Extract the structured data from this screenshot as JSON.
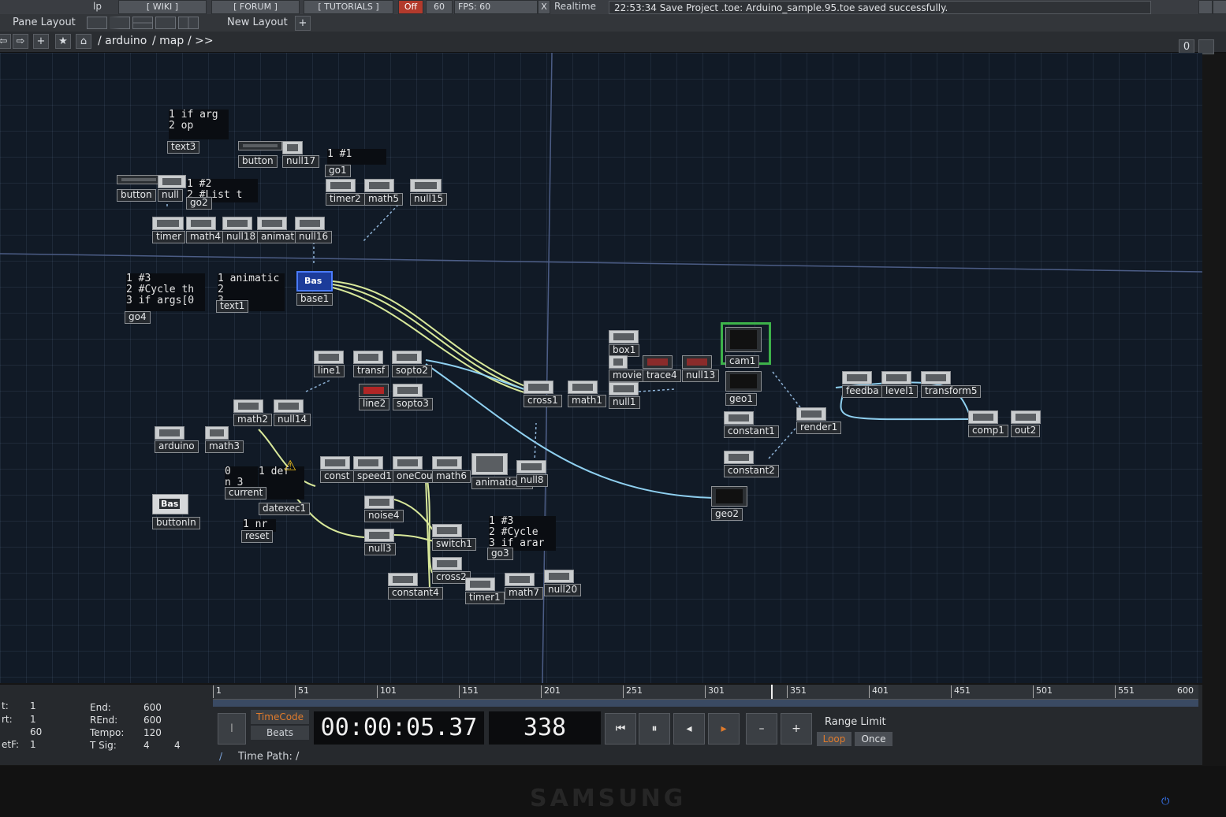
{
  "menu": {
    "help": "lp",
    "wiki": "[ WIKI ]",
    "forum": "[ FORUM ]",
    "tutorials": "[ TUTORIALS ]",
    "off": "Off",
    "fps_value": "60",
    "fps_label": "FPS: 60",
    "realtime_check": "X",
    "realtime": "Realtime"
  },
  "status": "22:53:34 Save Project .toe: Arduino_sample.95.toe saved successfully.",
  "pane_layout": {
    "label": "Pane Layout",
    "new_layout": "New Layout",
    "add": "+"
  },
  "nav": {
    "back": "⇦",
    "forward": "⇨",
    "add": "+",
    "star": "★",
    "home": "⌂",
    "path": [
      " / arduino",
      " / map",
      " / >>"
    ],
    "zero": "0"
  },
  "nodes": {
    "text3": "text3",
    "button": "button",
    "null17": "null17",
    "go1": "go1",
    "button2": "button",
    "null_b": "null",
    "go2": "go2",
    "timer2": "timer2",
    "math5": "math5",
    "null15": "null15",
    "timer": "timer",
    "math4": "math4",
    "null18": "null18",
    "animat": "animat",
    "null16": "null16",
    "go4": "go4",
    "text1": "text1",
    "base1": "base1",
    "base_tile": "Bas",
    "line1": "line1",
    "transf": "transf",
    "sopto2": "sopto2",
    "line2": "line2",
    "sopto3": "sopto3",
    "math2": "math2",
    "null14": "null14",
    "arduino": "arduino",
    "math3": "math3",
    "current": "current",
    "datexec1": "datexec1",
    "reset": "reset",
    "buttonIn": "buttonIn",
    "buttonIn_tile": "Bas",
    "const": "const",
    "speed1": "speed1",
    "oneCou": "oneCou",
    "math6": "math6",
    "animation1": "animation1",
    "null8": "null8",
    "noise4": "noise4",
    "null3": "null3",
    "switch1": "switch1",
    "go3": "go3",
    "cross2": "cross2",
    "constant4": "constant4",
    "timer1": "timer1",
    "math7": "math7",
    "null20": "null20",
    "box1": "box1",
    "movie": "movie",
    "trace4": "trace4",
    "null13": "null13",
    "cam1": "cam1",
    "cross1": "cross1",
    "math1": "math1",
    "null1": "null1",
    "geo1": "geo1",
    "constant1": "constant1",
    "constant2": "constant2",
    "geo2": "geo2",
    "render1": "render1",
    "feedback": "feedba",
    "level1": "level1",
    "transform5": "transform5",
    "comp1": "comp1",
    "out2": "out2",
    "def": "def"
  },
  "dats": {
    "text3": [
      "1  if arg",
      "2       op"
    ],
    "go1": "1  #1",
    "go2": [
      "1  #2",
      "2  #List t"
    ],
    "go4": [
      "1  #3",
      "2  #Cycle th",
      "3  if args[0"
    ],
    "text1": [
      "1  animatic",
      "2",
      "3"
    ],
    "current": [
      "     0",
      "n 3"
    ],
    "reset": "1  nr",
    "datexec1_line": "1",
    "go3": [
      "1  #3",
      "2  #Cycle",
      "3  if arar"
    ]
  },
  "timeline": {
    "ticks": [
      "1",
      "51",
      "101",
      "151",
      "201",
      "251",
      "301",
      "351",
      "401",
      "451",
      "501",
      "551",
      "600"
    ],
    "left": [
      {
        "label": "t:",
        "value": "1"
      },
      {
        "label": "rt:",
        "value": "1"
      },
      {
        "label": "",
        "value": "60"
      },
      {
        "label": "etF:",
        "value": "1"
      }
    ],
    "right": [
      {
        "label": "End:",
        "value": "600"
      },
      {
        "label": "REnd:",
        "value": "600"
      },
      {
        "label": "Tempo:",
        "value": "120"
      },
      {
        "label": "T Sig:",
        "value": "4",
        "value2": "4"
      }
    ],
    "timecode_btn": "TimeCode",
    "beats_btn": "Beats",
    "timecode": "00:00:05.37",
    "frame": "338",
    "range_limit": "Range Limit",
    "loop": "Loop",
    "once": "Once",
    "time_path": "Time Path: /",
    "slash": "/",
    "i_btn": "I",
    "controls": {
      "start": "⏮",
      "pause": "⏸",
      "back": "◂",
      "play": "▸",
      "minus": "–",
      "plus": "+"
    }
  },
  "monitor": {
    "brand": "SAMSUNG",
    "power": "⏻"
  },
  "colors": {
    "accent_green": "#3db24a",
    "wire_yellow": "#d8e89a",
    "wire_blue": "#8fd0f0",
    "play_orange": "#e07b2c"
  }
}
